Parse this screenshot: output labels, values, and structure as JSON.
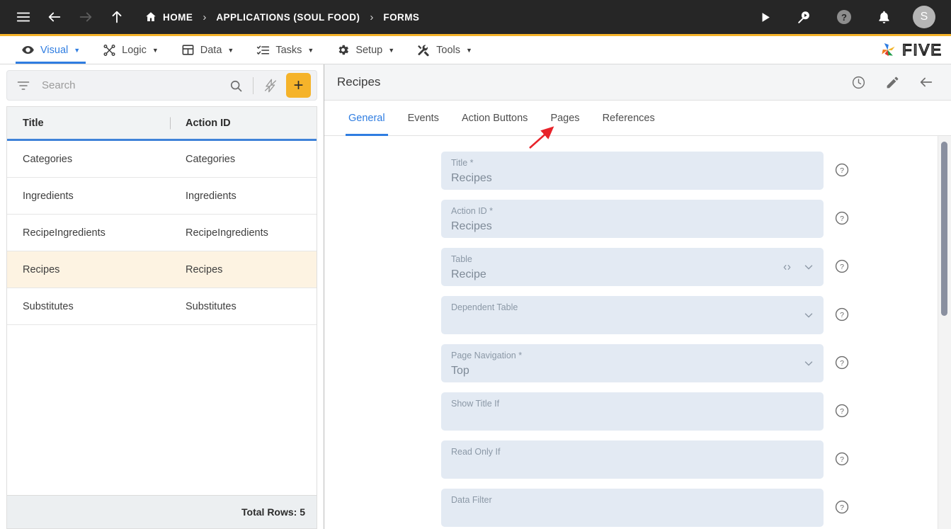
{
  "topbar": {
    "menu_icon": "hamburger-icon",
    "back_icon": "arrow-left-icon",
    "forward_icon": "arrow-right-icon",
    "up_icon": "arrow-up-icon",
    "home_label": "HOME",
    "sep": "›",
    "breadcrumbs": [
      "APPLICATIONS (SOUL FOOD)",
      "FORMS"
    ],
    "run_icon": "play-icon",
    "inspect_icon": "search-play-icon",
    "help_icon": "question-circle-icon",
    "bell_icon": "bell-icon",
    "avatar_initial": "S",
    "bg": "#262626",
    "accent": "#f5b32a"
  },
  "menubar": {
    "items": [
      {
        "label": "Visual",
        "icon": "eye-icon",
        "active": true
      },
      {
        "label": "Logic",
        "icon": "nodes-icon",
        "active": false
      },
      {
        "label": "Data",
        "icon": "grid-table-icon",
        "active": false
      },
      {
        "label": "Tasks",
        "icon": "checklist-icon",
        "active": false
      },
      {
        "label": "Setup",
        "icon": "gear-icon",
        "active": false
      },
      {
        "label": "Tools",
        "icon": "tools-icon",
        "active": false
      }
    ],
    "caret": "▼",
    "brand": "FIVE",
    "active_color": "#2f7de1"
  },
  "sidebar": {
    "search": {
      "placeholder": "Search",
      "value": ""
    },
    "filter_icon": "filter-icon",
    "search_icon": "search-icon",
    "lightning_icon": "lightning-disabled-icon",
    "add_label": "+",
    "columns": [
      "Title",
      "Action ID"
    ],
    "rows": [
      {
        "title": "Categories",
        "action_id": "Categories",
        "selected": false
      },
      {
        "title": "Ingredients",
        "action_id": "Ingredients",
        "selected": false
      },
      {
        "title": "RecipeIngredients",
        "action_id": "RecipeIngredients",
        "selected": false
      },
      {
        "title": "Recipes",
        "action_id": "Recipes",
        "selected": true
      },
      {
        "title": "Substitutes",
        "action_id": "Substitutes",
        "selected": false
      }
    ],
    "footer": "Total Rows: 5",
    "selected_row_bg": "#fdf3e2",
    "header_underline": "#4083d8"
  },
  "detail": {
    "title": "Recipes",
    "header_icons": [
      {
        "name": "history-clock-icon"
      },
      {
        "name": "edit-pencil-icon"
      },
      {
        "name": "back-arrow-icon"
      }
    ],
    "tabs": [
      {
        "label": "General",
        "active": true
      },
      {
        "label": "Events",
        "active": false
      },
      {
        "label": "Action Buttons",
        "active": false
      },
      {
        "label": "Pages",
        "active": false
      },
      {
        "label": "References",
        "active": false
      }
    ],
    "fields": [
      {
        "label": "Title *",
        "value": "Recipes",
        "icons": []
      },
      {
        "label": "Action ID *",
        "value": "Recipes",
        "icons": []
      },
      {
        "label": "Table",
        "value": "Recipe",
        "icons": [
          "code-brackets-icon",
          "chevron-down-icon"
        ]
      },
      {
        "label": "Dependent Table",
        "value": "",
        "icons": [
          "chevron-down-icon"
        ]
      },
      {
        "label": "Page Navigation *",
        "value": "Top",
        "icons": [
          "chevron-down-icon"
        ]
      },
      {
        "label": "Show Title If",
        "value": "",
        "icons": []
      },
      {
        "label": "Read Only If",
        "value": "",
        "icons": []
      },
      {
        "label": "Data Filter",
        "value": "",
        "icons": []
      }
    ],
    "help_icon": "question-circle-icon",
    "field_bg": "#e3eaf3"
  },
  "annotation": {
    "type": "arrow",
    "color": "#e8232a",
    "points_at": "Pages"
  }
}
